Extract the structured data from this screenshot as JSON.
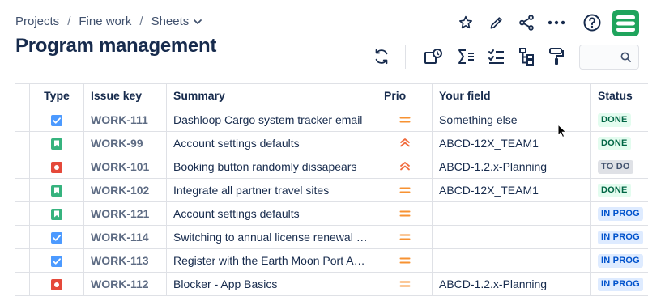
{
  "breadcrumb": {
    "items": [
      "Projects",
      "Fine work",
      "Sheets"
    ],
    "separator": "/"
  },
  "page_title": "Program management",
  "header_actions": [
    "star-icon",
    "edit-icon",
    "share-icon",
    "more-icon",
    "help-icon"
  ],
  "toolbar": {
    "icons": [
      "refresh-icon",
      "view-settings-icon",
      "sum-icon",
      "checklist-icon",
      "hierarchy-icon",
      "paint-roller-icon"
    ],
    "search": {
      "value": "",
      "placeholder": ""
    }
  },
  "colors": {
    "story": "#36b37e",
    "task": "#4c9aff",
    "bug": "#e5493a",
    "prio_medium": "#f79232",
    "prio_high": "#f16b3d",
    "done_bg": "#e3fcef",
    "done_fg": "#006644",
    "todo_bg": "#dfe1e6",
    "todo_fg": "#42526e",
    "inprog_bg": "#deebff",
    "inprog_fg": "#0052cc",
    "logo": "#1fa45c"
  },
  "table": {
    "columns": [
      "Type",
      "Issue key",
      "Summary",
      "Prio",
      "Your field",
      "Status"
    ],
    "rows": [
      {
        "type": "task",
        "key": "WORK-111",
        "summary": "Dashloop Cargo system tracker email",
        "prio": "medium",
        "field": "Something else",
        "status": "DONE",
        "status_kind": "done"
      },
      {
        "type": "story",
        "key": "WORK-99",
        "summary": "Account settings defaults",
        "prio": "high",
        "field": "ABCD-12X_TEAM1",
        "status": "DONE",
        "status_kind": "done"
      },
      {
        "type": "bug",
        "key": "WORK-101",
        "summary": "Booking button randomly dissapears",
        "prio": "high",
        "field": "ABCD-1.2.x-Planning",
        "status": "TO DO",
        "status_kind": "todo"
      },
      {
        "type": "story",
        "key": "WORK-102",
        "summary": "Integrate all partner travel sites",
        "prio": "medium",
        "field": "ABCD-12X_TEAM1",
        "status": "DONE",
        "status_kind": "done"
      },
      {
        "type": "story",
        "key": "WORK-121",
        "summary": "Account settings defaults",
        "prio": "medium",
        "field": "",
        "status": "IN PROG",
        "status_kind": "inprog"
      },
      {
        "type": "task",
        "key": "WORK-114",
        "summary": "Switching to annual license renewal process",
        "prio": "medium",
        "field": "",
        "status": "IN PROG",
        "status_kind": "inprog"
      },
      {
        "type": "task",
        "key": "WORK-113",
        "summary": "Register with the Earth Moon Port Authority",
        "prio": "medium",
        "field": "",
        "status": "IN PROG",
        "status_kind": "inprog"
      },
      {
        "type": "bug",
        "key": "WORK-112",
        "summary": "Blocker - App Basics",
        "prio": "medium",
        "field": "ABCD-1.2.x-Planning",
        "status": "IN PROG",
        "status_kind": "inprog"
      }
    ]
  }
}
